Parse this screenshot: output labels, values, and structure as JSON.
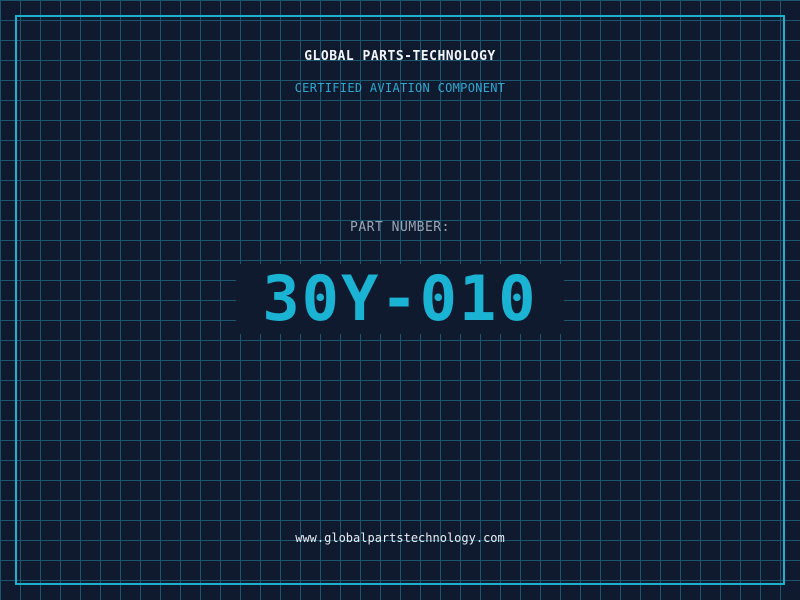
{
  "header": {
    "company": "GLOBAL PARTS-TECHNOLOGY",
    "subtitle": "CERTIFIED AVIATION COMPONENT"
  },
  "part": {
    "label": "PART NUMBER:",
    "number": "30Y-010"
  },
  "footer": {
    "website": "www.globalpartstechnology.com"
  },
  "colors": {
    "background": "#0f1a2e",
    "grid": "#1d5670",
    "accent": "#1cb0cf",
    "title": "#f2f5f8",
    "label": "#9aa6b6"
  }
}
